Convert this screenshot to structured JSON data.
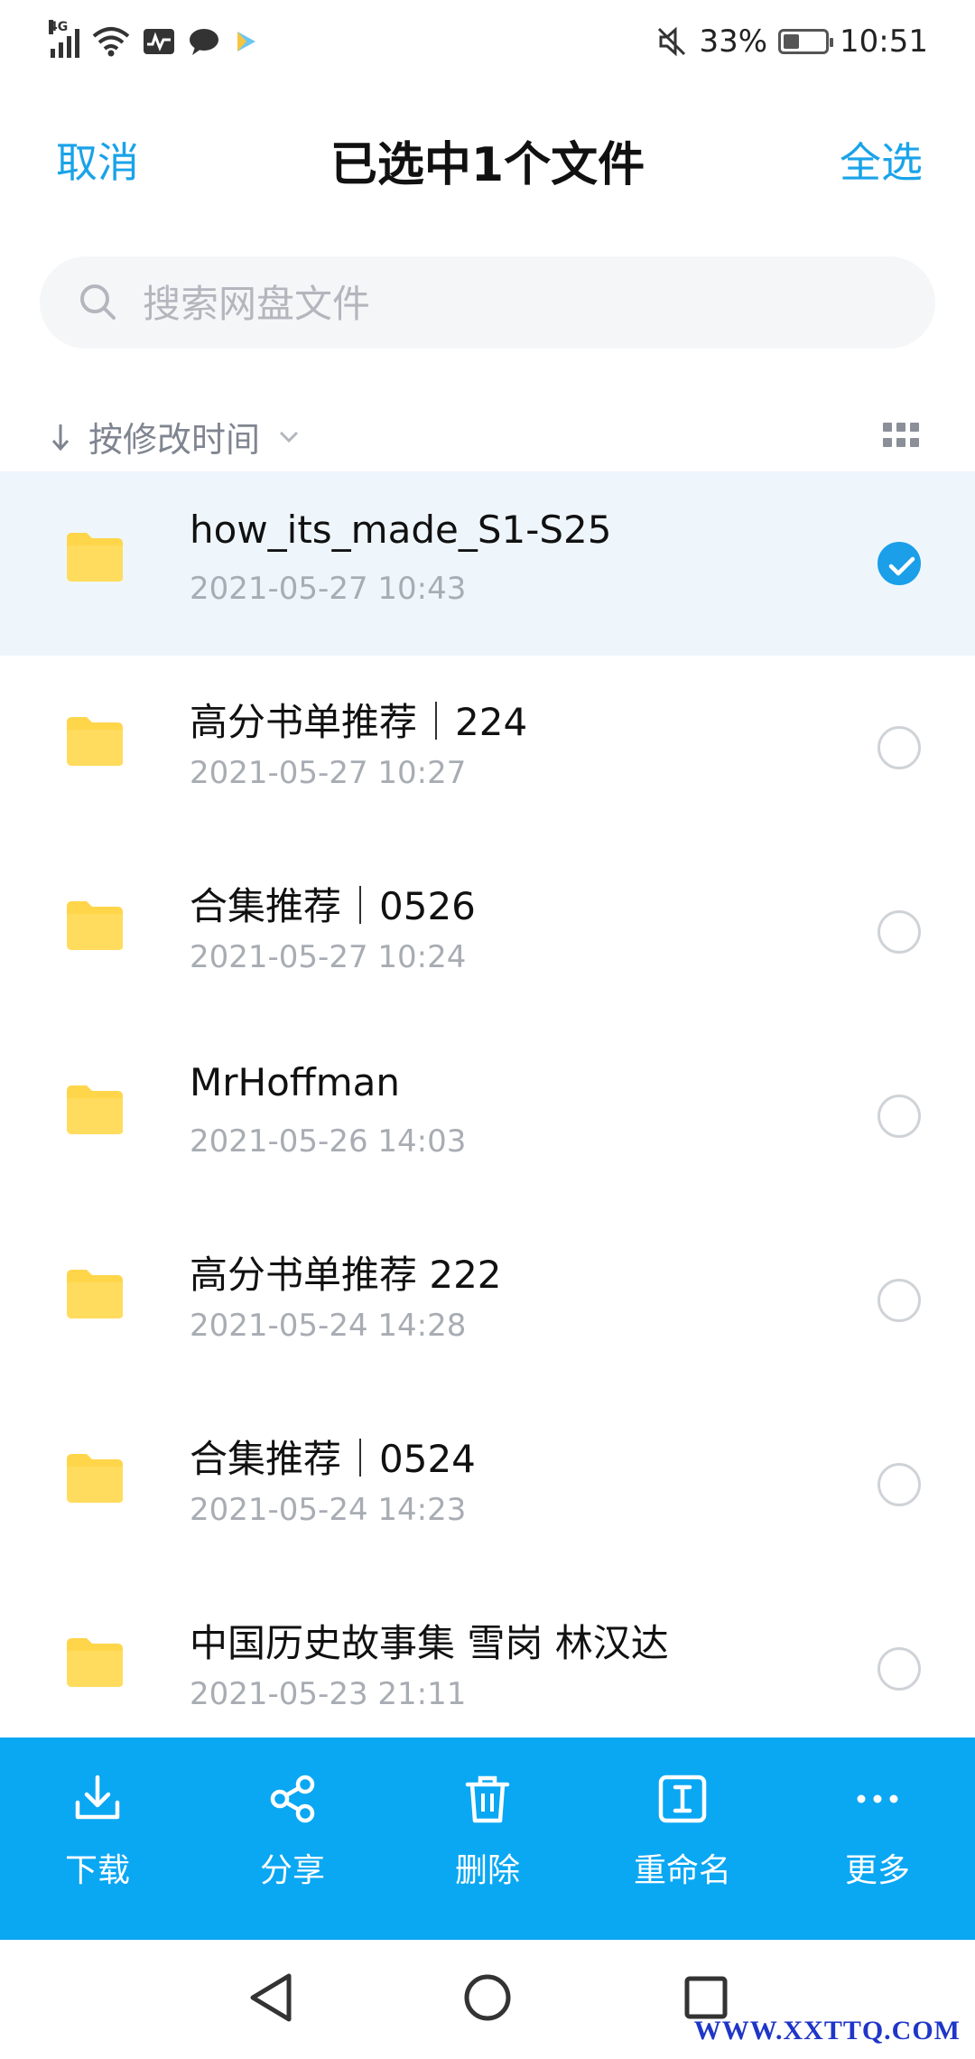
{
  "status_bar": {
    "network": "4G",
    "battery_percent": "33%",
    "battery_level": 0.33,
    "time": "10:51",
    "icons": [
      "signal-icon",
      "wifi-icon",
      "activity-icon",
      "chat-icon",
      "play-icon",
      "mute-icon",
      "battery-icon"
    ]
  },
  "header": {
    "cancel_label": "取消",
    "title": "已选中1个文件",
    "select_all_label": "全选"
  },
  "search": {
    "placeholder": "搜索网盘文件",
    "value": ""
  },
  "sort": {
    "label": "按修改时间"
  },
  "files": [
    {
      "name": "how_its_made_S1-S25",
      "date": "2021-05-27  10:43",
      "selected": true
    },
    {
      "name": "高分书单推荐｜224",
      "date": "2021-05-27  10:27",
      "selected": false
    },
    {
      "name": "合集推荐｜0526",
      "date": "2021-05-27  10:24",
      "selected": false
    },
    {
      "name": "MrHoffman",
      "date": "2021-05-26  14:03",
      "selected": false
    },
    {
      "name": "高分书单推荐 222",
      "date": "2021-05-24  14:28",
      "selected": false
    },
    {
      "name": "合集推荐｜0524",
      "date": "2021-05-24  14:23",
      "selected": false
    },
    {
      "name": "中国历史故事集 雪岗 林汉达",
      "date": "2021-05-23  21:11",
      "selected": false
    }
  ],
  "actions": [
    {
      "label": "下载",
      "icon": "download-icon"
    },
    {
      "label": "分享",
      "icon": "share-icon"
    },
    {
      "label": "删除",
      "icon": "trash-icon"
    },
    {
      "label": "重命名",
      "icon": "rename-icon"
    },
    {
      "label": "更多",
      "icon": "more-icon"
    }
  ],
  "watermark": "WWW.XXTTQ.COM",
  "colors": {
    "accent": "#1aa3e8",
    "action_bar": "#0aa7f3",
    "selected_row": "#eef6fc",
    "folder": "#ffd54a"
  }
}
